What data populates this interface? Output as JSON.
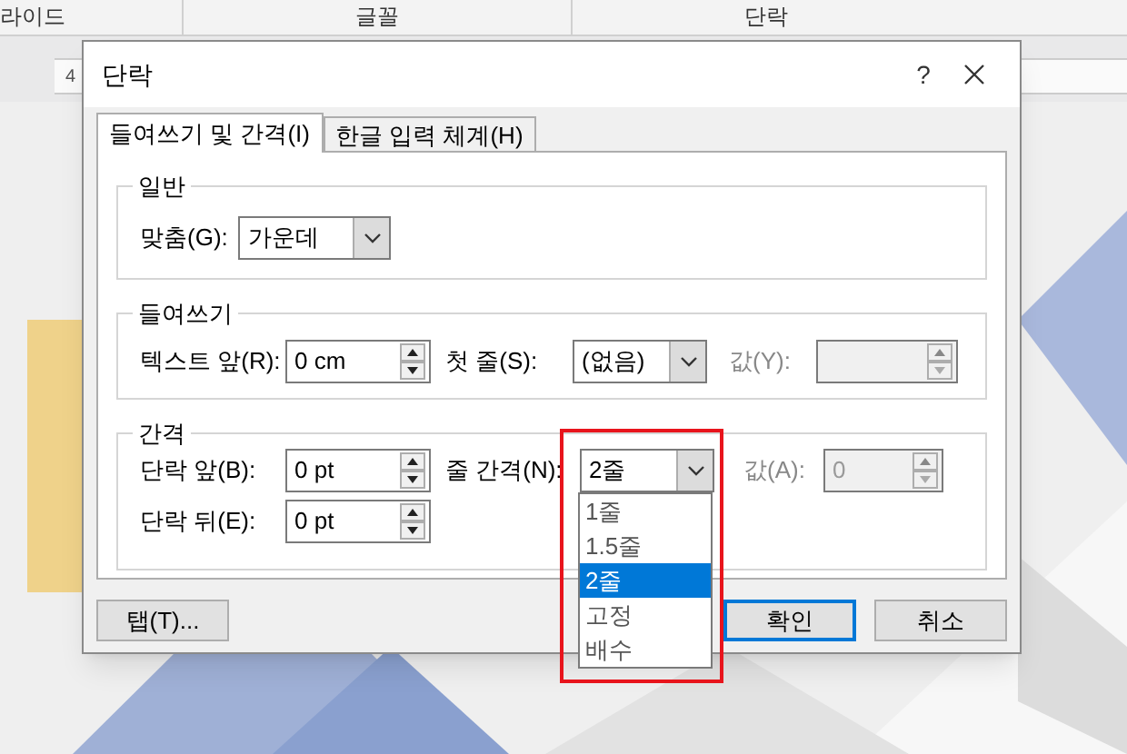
{
  "ribbon": {
    "groups": [
      "라이드",
      "글꼴",
      "단락"
    ]
  },
  "ruler": {
    "labels": [
      "4"
    ]
  },
  "dialog": {
    "title": "단락",
    "help": "?",
    "tabs": [
      {
        "label": "들여쓰기 및 간격(I)",
        "selected": true
      },
      {
        "label": "한글 입력 체계(H)",
        "selected": false
      }
    ],
    "general": {
      "title": "일반",
      "alignment": {
        "label": "맞춤(G):",
        "value": "가운데"
      }
    },
    "indentation": {
      "title": "들여쓰기",
      "before_text": {
        "label": "텍스트 앞(R):",
        "value": "0 cm"
      },
      "special": {
        "label": "첫 줄(S):",
        "value": "(없음)"
      },
      "by": {
        "label": "값(Y):",
        "disabled": true
      }
    },
    "spacing": {
      "title": "간격",
      "before": {
        "label": "단락 앞(B):",
        "value": "0 pt"
      },
      "after": {
        "label": "단락 뒤(E):",
        "value": "0 pt"
      },
      "line_spacing": {
        "label": "줄 간격(N):",
        "value": "2줄",
        "expanded": true,
        "highlighted": true,
        "options": [
          {
            "label": "1줄",
            "selected": false
          },
          {
            "label": "1.5줄",
            "selected": false
          },
          {
            "label": "2줄",
            "selected": true
          },
          {
            "label": "고정",
            "selected": false
          },
          {
            "label": "배수",
            "selected": false
          }
        ]
      },
      "at": {
        "label": "값(A):",
        "value": "0",
        "disabled": true
      }
    },
    "buttons": [
      {
        "label": "탭(T)...",
        "default": false
      },
      {
        "label": "확인",
        "default": true
      },
      {
        "label": "취소",
        "default": false
      }
    ]
  }
}
